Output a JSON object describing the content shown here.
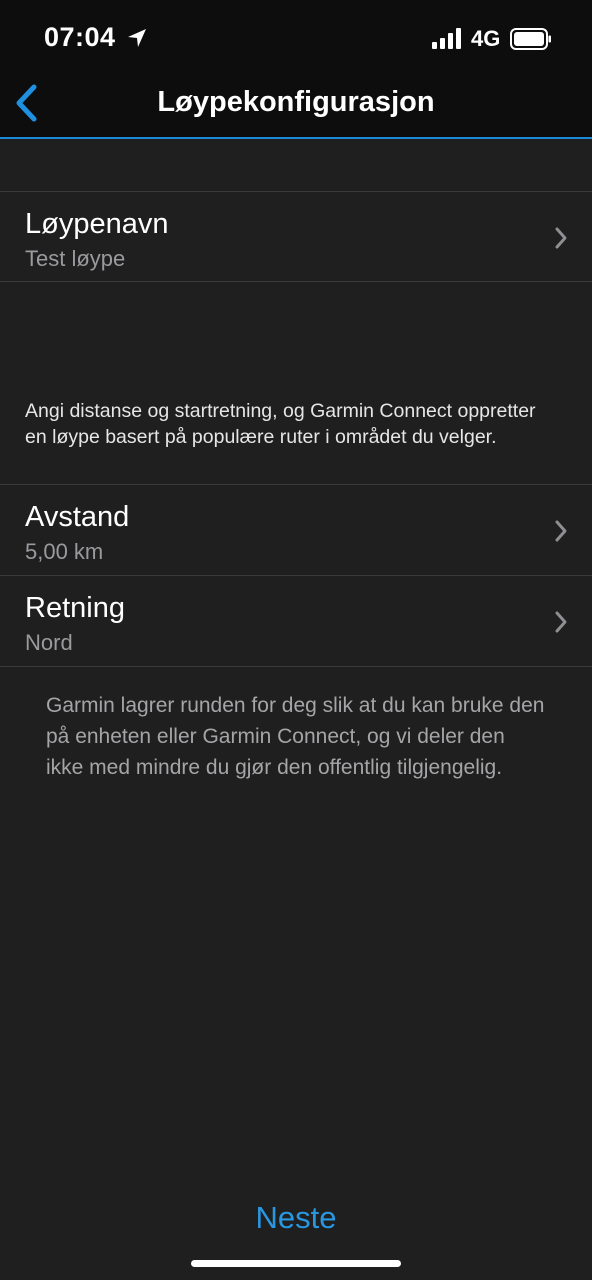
{
  "status_bar": {
    "time": "07:04",
    "network": "4G",
    "icons": [
      "location-arrow-icon",
      "signal-bars-icon",
      "battery-icon"
    ]
  },
  "nav": {
    "title": "Løypekonfigurasjon",
    "back_icon": "chevron-left-icon"
  },
  "rows": {
    "name": {
      "title": "Løypenavn",
      "value": "Test løype"
    },
    "distance": {
      "title": "Avstand",
      "value": "5,00 km"
    },
    "direction": {
      "title": "Retning",
      "value": "Nord"
    }
  },
  "description": "Angi distanse og startretning, og Garmin Connect oppretter en løype basert på populære ruter i området du velger.",
  "footer_note": "Garmin lagrer runden for deg slik at du kan bruke den på enheten eller Garmin Connect, og vi deler den ikke med mindre du gjør den offentlig tilgjengelig.",
  "next_label": "Neste",
  "colors": {
    "accent": "#2997e0",
    "background": "#1f1f1f",
    "header": "#0d0d0d"
  }
}
